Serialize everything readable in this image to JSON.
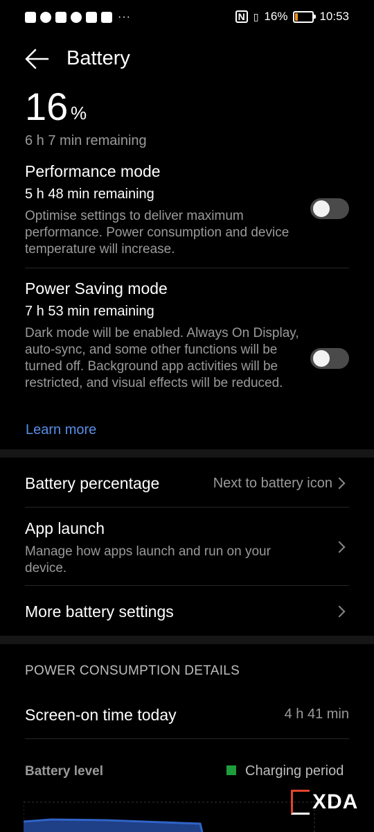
{
  "statusbar": {
    "battery_pct": "16%",
    "time": "10:53",
    "battery_fill_fraction": 0.16,
    "battery_fill_color": "#f08c1a"
  },
  "header": {
    "title": "Battery",
    "back_icon": "arrow-left-icon"
  },
  "summary": {
    "percent_value": "16",
    "percent_unit": "%",
    "remaining": "6 h 7 min remaining"
  },
  "performance_mode": {
    "title": "Performance mode",
    "remaining": "5 h 48 min remaining",
    "description": "Optimise settings to deliver maximum performance. Power consumption and device temperature will increase.",
    "enabled": false
  },
  "power_saving_mode": {
    "title": "Power Saving mode",
    "remaining": "7 h 53 min remaining",
    "description": "Dark mode will be enabled. Always On Display, auto-sync, and some other functions will be turned off. Background app activities will be restricted, and visual effects will be reduced.",
    "enabled": false
  },
  "learn_more": "Learn more",
  "settings": {
    "battery_percentage": {
      "title": "Battery percentage",
      "value": "Next to battery icon"
    },
    "app_launch": {
      "title": "App launch",
      "description": "Manage how apps launch and run on your device."
    },
    "more_settings": {
      "title": "More battery settings"
    }
  },
  "consumption": {
    "header": "POWER CONSUMPTION DETAILS",
    "screen_on": {
      "title": "Screen-on time today",
      "value": "4 h 41 min"
    },
    "battery_level": "Battery level",
    "legend": "Charging period",
    "legend_color": "#1e9e3a",
    "graph_color": "#2f64c8"
  },
  "watermark": "XDA",
  "colors": {
    "accent_link": "#5a8ee8",
    "secondary_text": "#9a9a9a",
    "toggle_off": "#4a4a4a"
  }
}
